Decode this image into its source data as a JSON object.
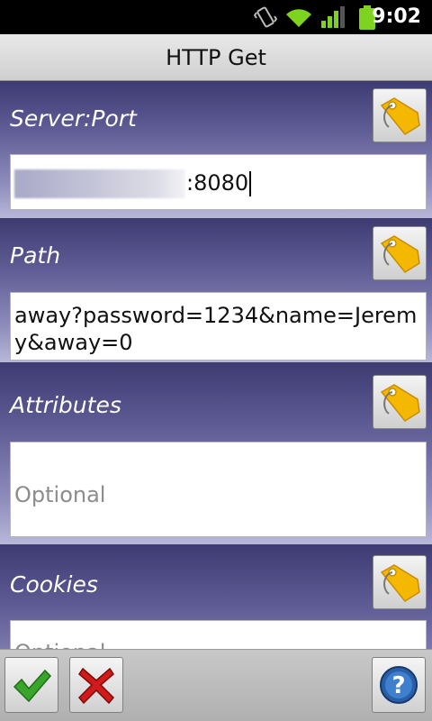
{
  "status_bar": {
    "time": "9:02",
    "icons": [
      "vibrate-icon",
      "wifi-icon",
      "signal-icon",
      "battery-icon"
    ]
  },
  "title": "HTTP Get",
  "sections": [
    {
      "label": "Server:Port",
      "value_suffix": ":8080",
      "value_prefix_redacted": true
    },
    {
      "label": "Path",
      "value": "away?password=1234&name=Jeremy&away=0"
    },
    {
      "label": "Attributes",
      "placeholder": "Optional",
      "value": ""
    },
    {
      "label": "Cookies",
      "placeholder": "Optional",
      "value": ""
    }
  ],
  "toolbar": {
    "ok_icon": "checkmark-icon",
    "cancel_icon": "red-x-icon",
    "help_icon": "question-icon"
  },
  "colors": {
    "section_gradient_top": "#3e3a72",
    "section_gradient_bottom": "#b9b7d8",
    "tag_icon": "#f5b800",
    "check_green": "#3aa52b",
    "cancel_red": "#d11a1a",
    "help_blue": "#2a5fa8"
  }
}
